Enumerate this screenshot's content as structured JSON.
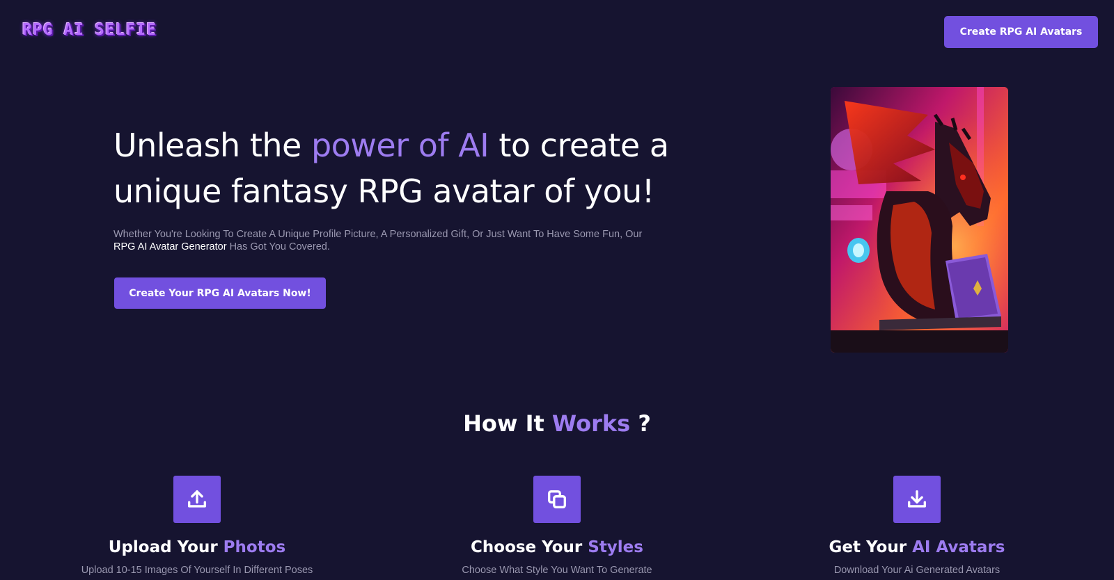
{
  "header": {
    "logo_text": "RPG AI SELFIE",
    "cta_label": "Create RPG AI Avatars"
  },
  "hero": {
    "title_part1": "Unleash the ",
    "title_accent": "power of AI",
    "title_part2": " to create a unique fantasy RPG avatar of you!",
    "desc_part1": "Whether You're Looking To Create A Unique Profile Picture, A Personalized Gift, Or Just Want To Have Some Fun, Our ",
    "desc_highlight": "RPG AI Avatar Generator",
    "desc_part2": " Has Got You Covered.",
    "cta_label": "Create Your RPG AI Avatars Now!",
    "image_subject": "dragon-with-laptop-illustration"
  },
  "how_it_works": {
    "title_part1": "How It ",
    "title_accent": "Works",
    "title_part2": " ?",
    "steps": [
      {
        "icon": "upload-icon",
        "title_part1": "Upload Your ",
        "title_accent": "Photos",
        "desc": "Upload 10-15 Images Of Yourself In Different Poses"
      },
      {
        "icon": "copy-styles-icon",
        "title_part1": "Choose Your ",
        "title_accent": "Styles",
        "desc": "Choose What Style You Want To Generate"
      },
      {
        "icon": "download-icon",
        "title_part1": "Get Your ",
        "title_accent": "AI Avatars",
        "desc": "Download Your Ai Generated Avatars"
      }
    ]
  },
  "colors": {
    "background": "#161430",
    "accent": "#9d7cf0",
    "button": "#7250df",
    "muted_text": "#9a98b0"
  }
}
